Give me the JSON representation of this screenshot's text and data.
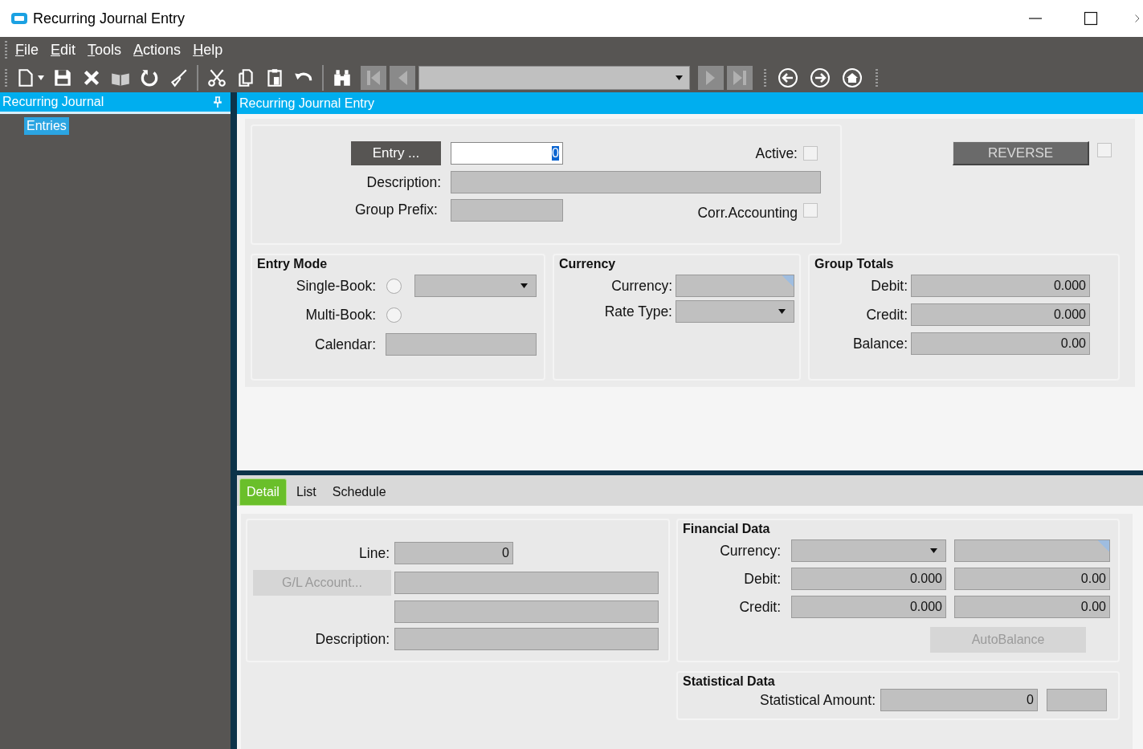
{
  "window": {
    "title": "Recurring Journal Entry"
  },
  "menu": [
    {
      "label": "File"
    },
    {
      "label": "Edit"
    },
    {
      "label": "Tools"
    },
    {
      "label": "Actions"
    },
    {
      "label": "Help"
    }
  ],
  "navigator": {
    "title": "Recurring Journal",
    "items": [
      {
        "label": "Entries",
        "selected": true
      }
    ]
  },
  "form": {
    "title": "Recurring Journal Entry",
    "entry_button": "Entry ...",
    "entry_value": "0",
    "entry_value_selected": true,
    "active": {
      "label": "Active:",
      "checked": false
    },
    "description_label": "Description:",
    "group_prefix_label": "Group Prefix:",
    "corr_accounting": {
      "label": "Corr.Accounting",
      "checked": false
    },
    "reverse": {
      "label": "REVERSE",
      "checked": false
    }
  },
  "entry_mode": {
    "title": "Entry Mode",
    "single_book": {
      "label": "Single-Book:",
      "selected": false
    },
    "multi_book": {
      "label": "Multi-Book:",
      "selected": false
    },
    "calendar_label": "Calendar:"
  },
  "currency": {
    "title": "Currency",
    "currency_label": "Currency:",
    "rate_type_label": "Rate Type:"
  },
  "group_totals": {
    "title": "Group Totals",
    "rows": [
      {
        "label": "Debit:",
        "value": "0.000"
      },
      {
        "label": "Credit:",
        "value": "0.000"
      },
      {
        "label": "Balance:",
        "value": "0.00"
      }
    ]
  },
  "tabs": [
    {
      "label": "Detail",
      "selected": true
    },
    {
      "label": "List",
      "selected": false
    },
    {
      "label": "Schedule",
      "selected": false
    }
  ],
  "detail": {
    "line": {
      "label": "Line:",
      "value": "0"
    },
    "gl_account_button": {
      "label": "G/L Account...",
      "disabled": true
    },
    "description_label": "Description:"
  },
  "financial_data": {
    "title": "Financial Data",
    "currency_label": "Currency:",
    "rows": [
      {
        "label": "Debit:",
        "value": "0.000",
        "book_value": "0.00"
      },
      {
        "label": "Credit:",
        "value": "0.000",
        "book_value": "0.00"
      }
    ],
    "autobalance": {
      "label": "AutoBalance",
      "disabled": true
    }
  },
  "statistical_data": {
    "title": "Statistical Data",
    "amount": {
      "label": "Statistical Amount:",
      "value": "0"
    }
  }
}
